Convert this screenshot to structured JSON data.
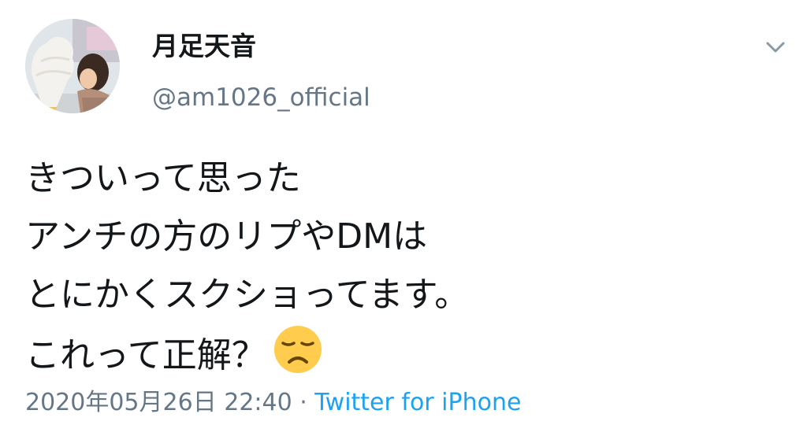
{
  "author": {
    "display_name": "月足天音",
    "handle": "@am1026_official"
  },
  "tweet": {
    "lines": [
      "きついって思った",
      "アンチの方のリプやDMは",
      "とにかくスクショってます。",
      "これって正解？"
    ],
    "emoji": "disappointed-face"
  },
  "meta": {
    "timestamp": "2020年05月26日 22:40",
    "separator": " · ",
    "source": "Twitter for iPhone"
  },
  "icons": {
    "menu": "chevron-down-icon",
    "avatar": "profile-photo"
  },
  "colors": {
    "text": "#14171a",
    "secondary": "#657786",
    "link": "#1da1f2",
    "emoji": "#ffcc4d"
  }
}
